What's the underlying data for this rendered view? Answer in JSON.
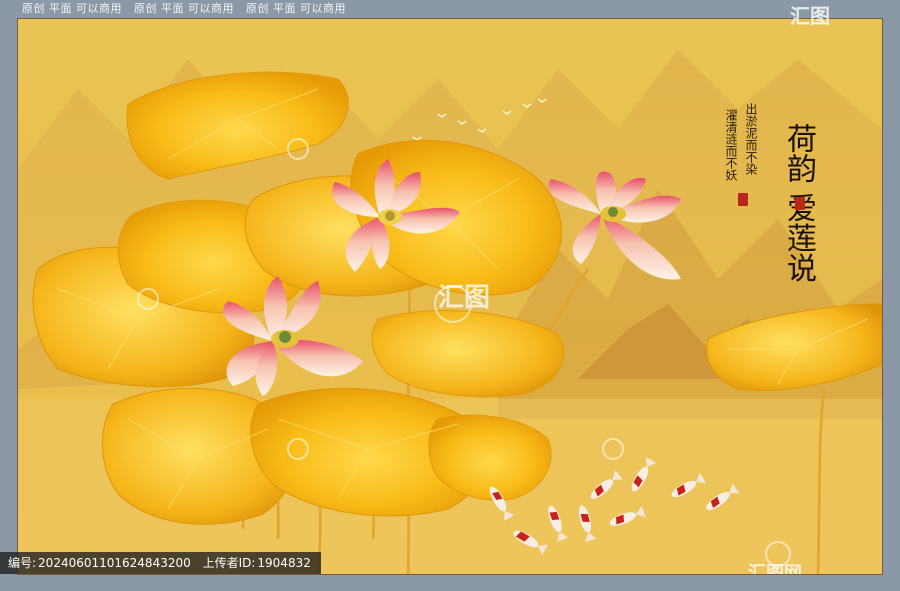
{
  "watermark": {
    "top_labels": [
      "原创 平面 可以商用",
      "原创 平面 可以商用",
      "原创 平面 可以商用"
    ],
    "logo_text": "汇图",
    "logo_mark": "汇图网"
  },
  "artwork": {
    "title_vertical": "荷韵 爱莲说",
    "poem_col1": "出淤泥而不染",
    "poem_col2": "濯清涟而不妖",
    "colors": {
      "background_gold": "#e6b945",
      "leaf_gold": "#f2b51c",
      "leaf_edge": "#e09a0a",
      "lotus_pink": "#e8506a",
      "lotus_white": "#fff3e6",
      "koi_red": "#c8231b",
      "seal_red": "#b8261c"
    }
  },
  "footer": {
    "id_label": "编号:",
    "id_value": "20240601101624843200",
    "uploader_label": "上传者ID:",
    "uploader_value": "1904832"
  }
}
